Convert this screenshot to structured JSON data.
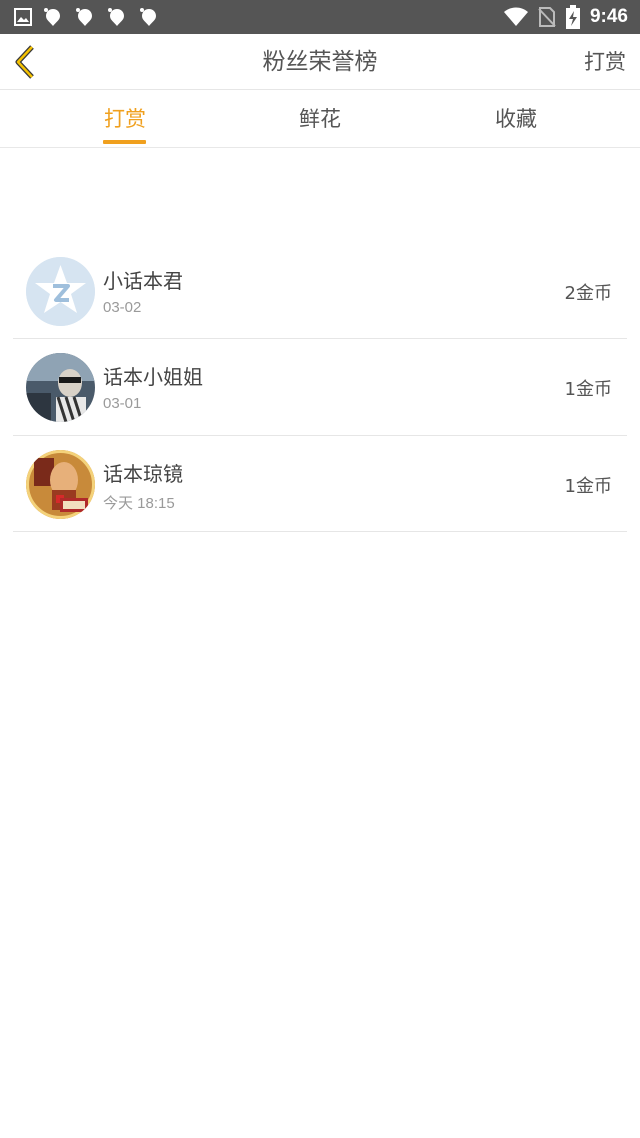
{
  "status_bar": {
    "time": "9:46",
    "left_icons": [
      "image-icon",
      "notification-icon",
      "notification-icon",
      "notification-icon",
      "notification-icon"
    ],
    "right_icons": [
      "wifi-icon",
      "no-sim-icon",
      "battery-charging-icon"
    ]
  },
  "header": {
    "title": "粉丝荣誉榜",
    "action_label": "打赏",
    "back_icon": "chevron-left-icon",
    "accent_color": "#f0a01e"
  },
  "tabs": [
    {
      "label": "打赏",
      "active": true
    },
    {
      "label": "鲜花",
      "active": false
    },
    {
      "label": "收藏",
      "active": false
    }
  ],
  "fans": [
    {
      "name": "小话本君",
      "date": "03-02",
      "amount": "2金币",
      "avatar": "qq-logo-avatar"
    },
    {
      "name": "话本小姐姐",
      "date": "03-01",
      "amount": "1金币",
      "avatar": "photo-avatar"
    },
    {
      "name": "话本琼镜",
      "date": "今天 18:15",
      "amount": "1金币",
      "avatar": "photo-avatar"
    }
  ]
}
